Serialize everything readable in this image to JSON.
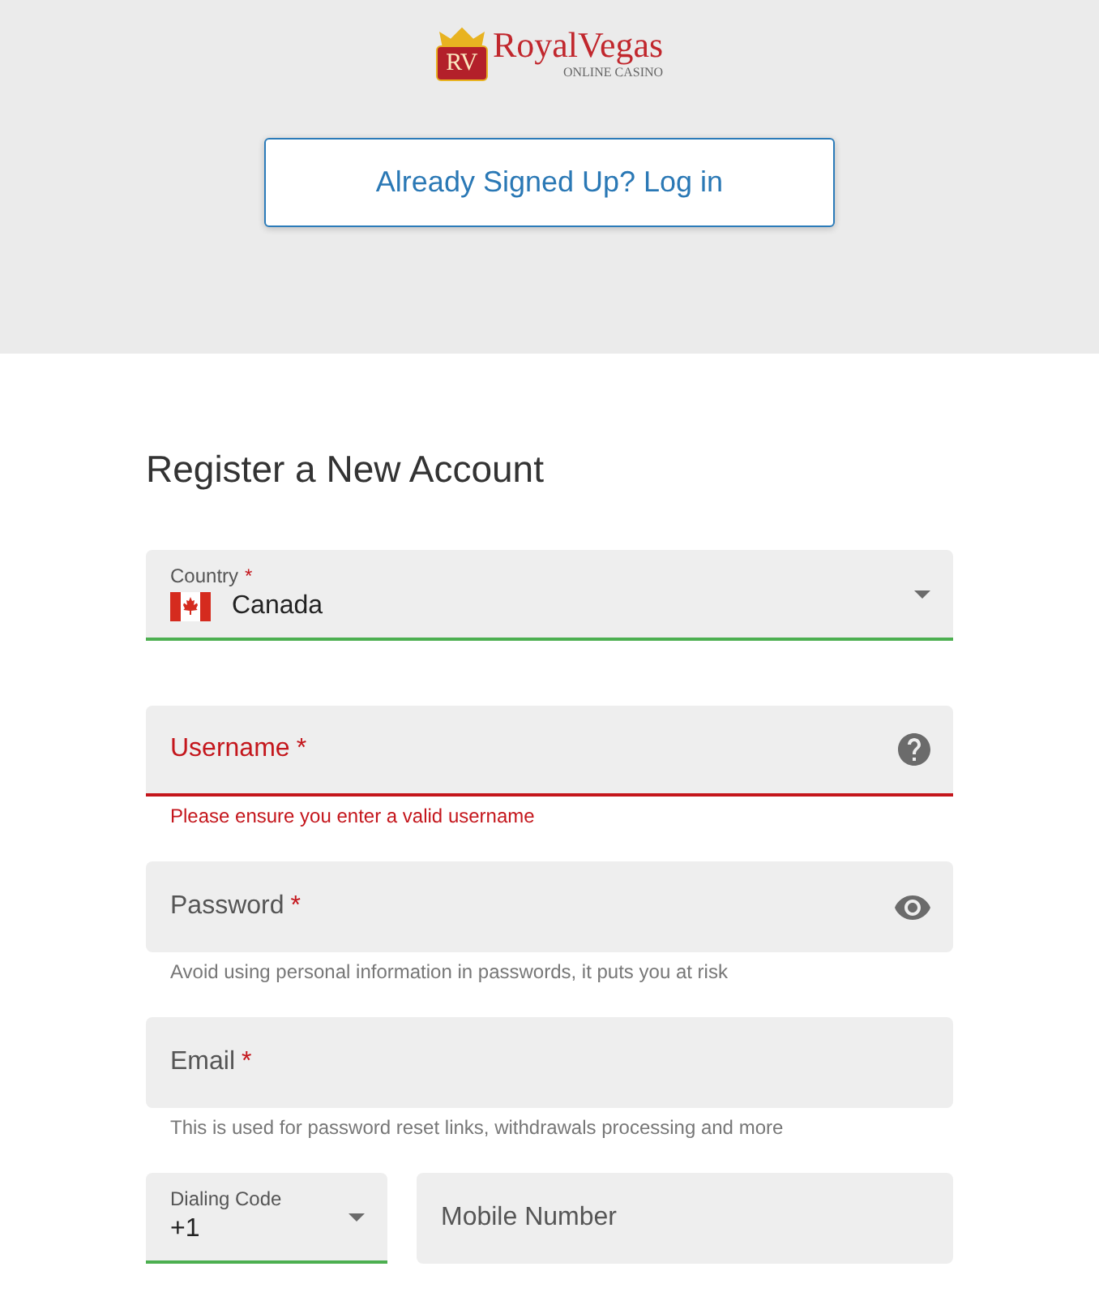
{
  "header": {
    "logo": {
      "monogram": "RV",
      "wordmark": "RoyalVegas",
      "tagline": "ONLINE CASINO"
    },
    "login_button": "Already Signed Up? Log in"
  },
  "form": {
    "title": "Register a New Account",
    "fields": [
      {
        "kind": "country",
        "label": "Country",
        "required_mark": "*",
        "value": "Canada",
        "valid": true,
        "error": false
      },
      {
        "kind": "username",
        "label": "Username",
        "required_mark": "*",
        "valid": false,
        "error": true,
        "helper": "Please ensure you enter a valid username"
      },
      {
        "kind": "password",
        "label": "Password",
        "required_mark": "*",
        "valid": false,
        "error": false,
        "helper": "Avoid using personal information in passwords, it puts you at risk"
      },
      {
        "kind": "email",
        "label": "Email",
        "required_mark": "*",
        "valid": false,
        "error": false,
        "helper": "This is used for password reset links, withdrawals processing and more"
      }
    ],
    "phone_fields": [
      {
        "kind": "dialing_code",
        "label": "Dialing Code",
        "value": "+1",
        "valid": true,
        "error": false
      },
      {
        "kind": "mobile",
        "label": "Mobile Number",
        "valid": false,
        "error": false
      }
    ]
  }
}
